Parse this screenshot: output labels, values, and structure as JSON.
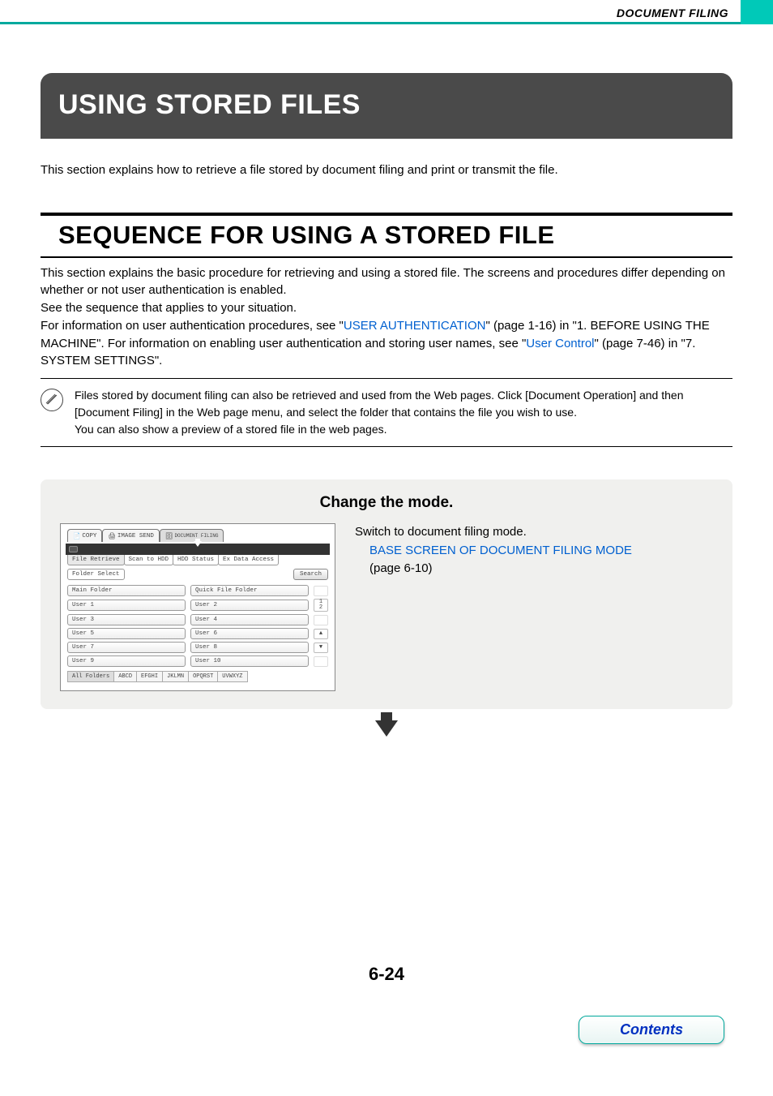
{
  "header_name": "DOCUMENT FILING",
  "title": "USING STORED FILES",
  "intro": "This section explains how to retrieve a file stored by document filing and print or transmit the file.",
  "section_title": "SEQUENCE FOR USING A STORED FILE",
  "body": {
    "p1a": "This section explains the basic procedure for retrieving and using a stored file. The screens and procedures differ depending on whether or not user authentication is enabled.",
    "p1b": "See the sequence that applies to your situation.",
    "p2a": "For information on user authentication procedures, see \"",
    "link1": "USER AUTHENTICATION",
    "p2b": "\" (page 1-16) in \"1. BEFORE USING THE MACHINE\". For information on enabling user authentication and storing user names, see \"",
    "link2": "User Control",
    "p2c": "\" (page 7-46) in \"7. SYSTEM SETTINGS\"."
  },
  "note": "Files stored by document filing can also be retrieved and used from the Web pages. Click [Document Operation] and then [Document Filing] in the Web page menu, and select the folder that contains the file you wish to use.\nYou can also show a preview of a stored file in the web pages.",
  "step": {
    "title": "Change the mode.",
    "desc1": "Switch to document filing mode.",
    "desc_link": "BASE SCREEN OF DOCUMENT FILING MODE",
    "desc_page": "(page 6-10)"
  },
  "screen": {
    "modetabs": [
      "COPY",
      "IMAGE SEND",
      "DOCUMENT FILING"
    ],
    "subtabs": [
      "File Retrieve",
      "Scan to HDD",
      "HDD Status",
      "Ex Data Access"
    ],
    "folderselect": "Folder Select",
    "search": "Search",
    "main_folder": "Main Folder",
    "quick_folder": "Quick File Folder",
    "users_left": [
      "User 1",
      "User 3",
      "User 5",
      "User 7",
      "User 9"
    ],
    "users_right": [
      "User 2",
      "User 4",
      "User 6",
      "User 8",
      "User 10"
    ],
    "pages": "1\n2",
    "alpha": [
      "All Folders",
      "ABCD",
      "EFGHI",
      "JKLMN",
      "OPQRST",
      "UVWXYZ"
    ]
  },
  "page_num": "6-24",
  "contents": "Contents"
}
